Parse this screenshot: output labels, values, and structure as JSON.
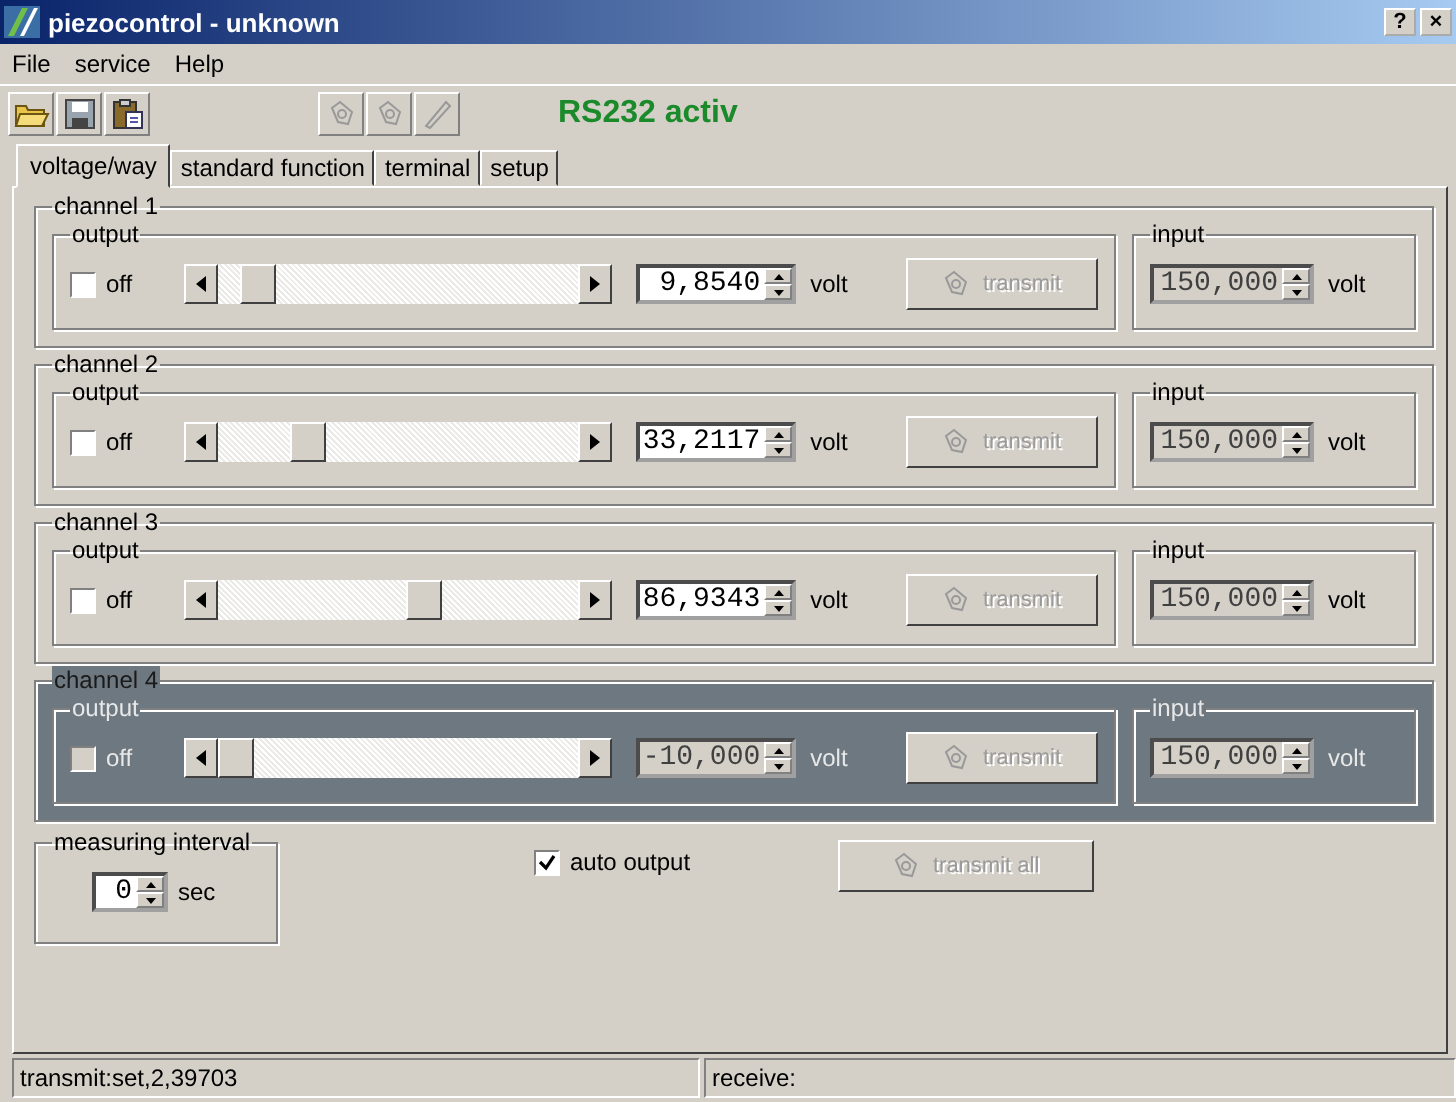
{
  "window": {
    "title": "piezocontrol - unknown",
    "buttons": [
      "?",
      "×"
    ]
  },
  "menu": [
    "File",
    "service",
    "Help"
  ],
  "toolbar": {
    "status": "RS232 activ"
  },
  "tabs": [
    {
      "label": "voltage/way",
      "selected": true
    },
    {
      "label": "standard function",
      "selected": false
    },
    {
      "label": "terminal",
      "selected": false
    },
    {
      "label": "setup",
      "selected": false
    }
  ],
  "channels": [
    {
      "title": "channel 1",
      "output_label": "output",
      "off_label": "off",
      "off": false,
      "level": 0.07,
      "value": "9,8540",
      "unit": "volt",
      "transmit": "transmit",
      "transmit_disabled": true,
      "input_label": "input",
      "input_value": "150,000",
      "input_unit": "volt",
      "disabled": false
    },
    {
      "title": "channel 2",
      "output_label": "output",
      "off_label": "off",
      "off": false,
      "level": 0.22,
      "value": "33,2117",
      "unit": "volt",
      "transmit": "transmit",
      "transmit_disabled": true,
      "input_label": "input",
      "input_value": "150,000",
      "input_unit": "volt",
      "disabled": false
    },
    {
      "title": "channel 3",
      "output_label": "output",
      "off_label": "off",
      "off": false,
      "level": 0.58,
      "value": "86,9343",
      "unit": "volt",
      "transmit": "transmit",
      "transmit_disabled": true,
      "input_label": "input",
      "input_value": "150,000",
      "input_unit": "volt",
      "disabled": false
    },
    {
      "title": "channel 4",
      "output_label": "output",
      "off_label": "off",
      "off": false,
      "level": 0.0,
      "value": "-10,000",
      "unit": "volt",
      "transmit": "transmit",
      "transmit_disabled": true,
      "input_label": "input",
      "input_value": "150,000",
      "input_unit": "volt",
      "disabled": true
    }
  ],
  "interval": {
    "label": "measuring interval",
    "value": "0",
    "unit": "sec"
  },
  "auto_output": {
    "label": "auto output",
    "checked": true
  },
  "transmit_all": {
    "label": "transmit all",
    "disabled": true
  },
  "status_bar": [
    "transmit:set,2,39703",
    "receive:"
  ]
}
